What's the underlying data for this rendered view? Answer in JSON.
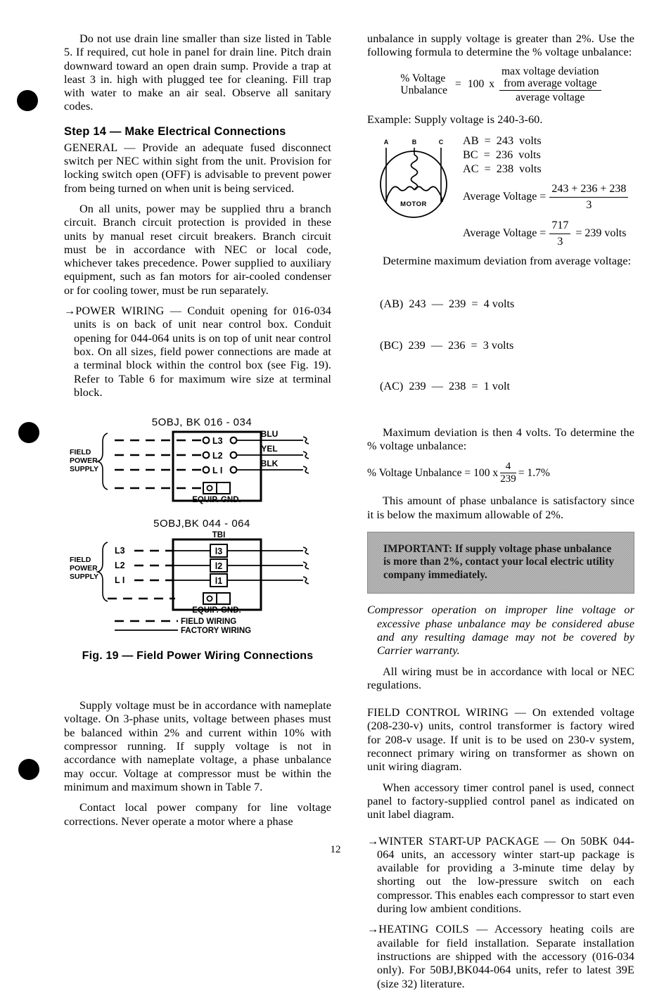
{
  "page": {
    "number": "12"
  },
  "markers": {
    "count": 3
  },
  "left_column": {
    "para_drain": "Do not use drain line smaller than size listed in Table 5. If required, cut hole in panel for drain line. Pitch drain downward toward an open drain sump. Provide a trap at least 3 in. high with plugged tee for cleaning. Fill trap with water to make an air seal. Observe all sanitary codes.",
    "step_heading": "Step 14 — Make Electrical Connections",
    "para_general": "GENERAL — Provide an adequate fused disconnect switch per NEC within sight from the unit. Provision for locking switch open (OFF) is advisable to prevent power from being turned on when unit is being serviced.",
    "para_branch": "On all units, power may be supplied thru a branch circuit. Branch circuit protection is provided in these units by manual reset circuit breakers. Branch circuit must be in accordance with NEC or local code, whichever takes precedence. Power supplied to auxiliary equipment, such as fan motors for air-cooled condenser or for cooling tower, must be run separately.",
    "para_power_wiring": "→POWER WIRING — Conduit opening for 016-034 units is on back of unit near control box. Conduit opening for 044-064 units is on top of unit near control box. On all sizes, field power connections are made at a terminal block within the control box (see Fig. 19). Refer to Table 6 for maximum wire size at terminal block.",
    "para_supply_voltage": "Supply voltage must be in accordance with nameplate voltage. On 3-phase units, voltage between phases must be balanced within 2% and current within 10% with compressor running. If supply voltage is not in accordance with nameplate voltage, a phase unbalance may occur. Voltage at compressor must be within the minimum and maximum shown in Table 7.",
    "para_contact": "Contact local power company for line voltage corrections. Never operate a motor where a phase"
  },
  "figure": {
    "caption": "Fig. 19 — Field Power Wiring Connections",
    "diagram_top": {
      "title": "5OBJ, BK 016 - 034",
      "supply_label_lines": [
        "FIELD",
        "POWER",
        "SUPPLY"
      ],
      "terminals": [
        "L3",
        "L2",
        "L I"
      ],
      "ground_label": "EQUIP. GND.",
      "wire_colors": [
        "BLU",
        "YEL",
        "BLK"
      ]
    },
    "diagram_bottom": {
      "title": "5OBJ,BK 044 - 064",
      "block_label": "TBI",
      "supply_label_lines": [
        "FIELD",
        "POWER",
        "SUPPLY"
      ],
      "line_labels": [
        "L3",
        "L2",
        "L I"
      ],
      "terminal_numbers": [
        "l3",
        "l2",
        "l1"
      ],
      "ground_label": "EQUIP. GND."
    },
    "legend": {
      "field_wiring": "FIELD WIRING",
      "factory_wiring": "FACTORY  WIRING"
    }
  },
  "right_column": {
    "para_unbalance": "unbalance in supply voltage is greater than 2%. Use the following formula to determine the % voltage unbalance:",
    "formula_unbalance": {
      "lhs_line1": "% Voltage",
      "lhs_line2": "Unbalance",
      "equals": "=",
      "hundred": "100",
      "times": "x",
      "numerator_line1": "max voltage deviation",
      "numerator_line2": "from average voltage",
      "denominator": "average voltage"
    },
    "para_example": "Example: Supply voltage is 240-3-60.",
    "motor_diagram": {
      "terminal_a": "A",
      "terminal_b": "B",
      "terminal_c": "C",
      "label": "MOTOR"
    },
    "voltage_readings": [
      "AB  =  243  volts",
      "BC  =  236  volts",
      "AC  =  238  volts"
    ],
    "average_1": {
      "label": "Average Voltage  =",
      "numerator": "243 + 236 + 238",
      "denominator": "3"
    },
    "average_2": {
      "label": "Average Voltage  =",
      "numerator": "717",
      "denominator": "3",
      "result": "=  239  volts"
    },
    "para_determine": "Determine maximum deviation from average voltage:",
    "deviation_rows": [
      "(AB)  243  —  239  =  4 volts",
      "(BC)  239  —  236  =  3 volts",
      "(AC)  239  —  238  =  1 volt"
    ],
    "para_max_deviation": "Maximum deviation is then 4 volts. To determine the % voltage unbalance:",
    "formula_result": {
      "lhs": "% Voltage Unbalance  =  100  x",
      "numerator": "4",
      "denominator": "239",
      "result": "=  1.7%"
    },
    "para_satisfactory": "This amount of phase unbalance is satisfactory since it is below the maximum allowable of 2%.",
    "important_note": "IMPORTANT: If supply voltage phase unbalance is more than 2%, contact your local electric utility company immediately.",
    "para_warranty": "Compressor operation on improper line voltage or excessive phase unbalance may be considered abuse and any resulting damage may not be covered by Carrier warranty.",
    "para_all_wiring": "All wiring must be in accordance with local or NEC regulations.",
    "para_field_control": "FIELD CONTROL WIRING — On extended voltage (208-230-v) units, control transformer is factory wired for 208-v usage. If unit is to be used on 230-v system, reconnect primary wiring on transformer as shown on unit wiring diagram.",
    "para_timer": "When accessory timer control panel is used, connect panel to factory-supplied control panel as indicated on unit label diagram.",
    "para_winter": "→WINTER START-UP PACKAGE — On 50BK 044-064 units, an accessory winter start-up package is available for providing a 3-minute time delay by shorting out the low-pressure switch on each compressor. This enables each compressor to start even during low ambient conditions.",
    "para_heating": "→HEATING COILS — Accessory heating coils are available for field installation. Separate installation instructions are shipped with the accessory (016-034 only). For 50BJ,BK044-064 units, refer to latest 39E (size 32) literature."
  }
}
